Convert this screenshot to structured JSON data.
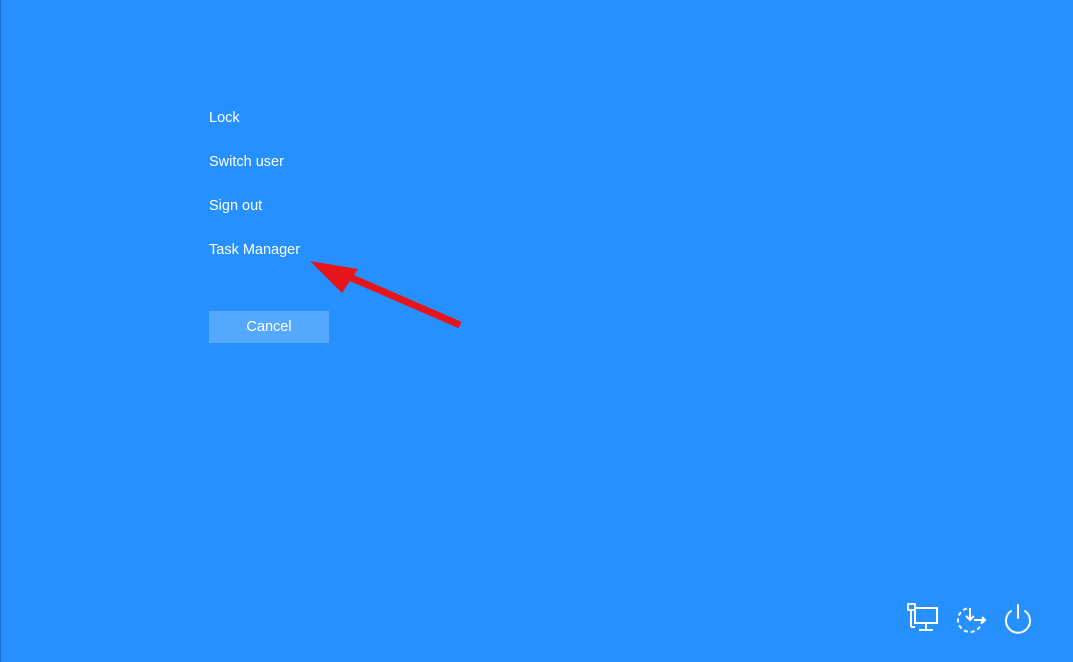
{
  "menu": {
    "lock": "Lock",
    "switch_user": "Switch user",
    "sign_out": "Sign out",
    "task_manager": "Task Manager"
  },
  "cancel_label": "Cancel",
  "system_icons": {
    "network": "network-icon",
    "accessibility": "ease-of-access-icon",
    "power": "power-icon"
  },
  "colors": {
    "background": "#2590fe",
    "cancel_button": "#54a9ff",
    "annotation_arrow": "#e8141c",
    "text": "#ffffff"
  }
}
